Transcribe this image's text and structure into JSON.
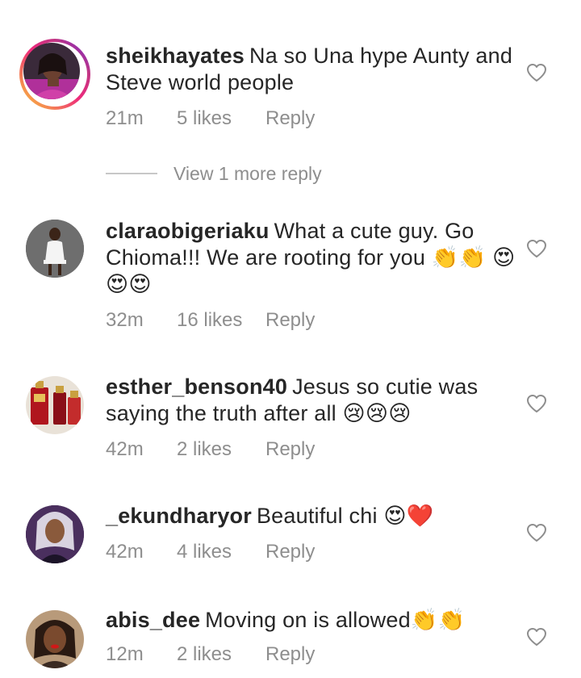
{
  "comments": [
    {
      "username": "sheikhayates",
      "text": "Na so Una hype Aunty and Steve world people",
      "time": "21m",
      "likes": "5 likes",
      "reply": "Reply",
      "avatar_icon": "profile-photo-woman-pink",
      "has_story_ring": true
    },
    {
      "username": "claraobigeriaku",
      "text": "What a cute guy. Go Chioma!!! We are rooting for you 👏👏 😍😍😍",
      "time": "32m",
      "likes": "16 likes",
      "reply": "Reply",
      "avatar_icon": "profile-photo-woman-white-dress"
    },
    {
      "username": "esther_benson40",
      "text": "Jesus so cutie was saying the truth after all 😢😢😢",
      "time": "42m",
      "likes": "2 likes",
      "reply": "Reply",
      "avatar_icon": "profile-photo-perfume-bottles"
    },
    {
      "username": "_ekundharyor",
      "text": "Beautiful chi 😍❤️",
      "time": "42m",
      "likes": "4 likes",
      "reply": "Reply",
      "avatar_icon": "profile-photo-woman-purple"
    },
    {
      "username": "abis_dee",
      "text": "Moving  on is allowed👏👏",
      "time": "12m",
      "likes": "2 likes",
      "reply": "Reply",
      "avatar_icon": "profile-photo-woman-red-lips"
    }
  ],
  "view_more_reply": "View 1 more reply",
  "icons": {
    "like": "heart-outline-icon"
  },
  "colors": {
    "meta_gray": "#8e8e8e",
    "text": "#262626",
    "divider": "#c7c7c7"
  }
}
